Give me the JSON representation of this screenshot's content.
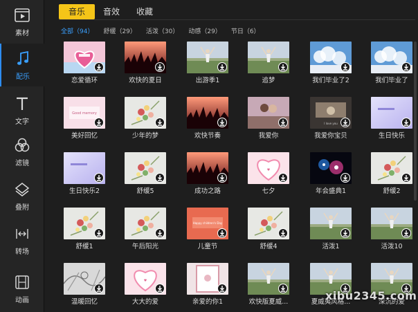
{
  "sidebar": {
    "items": [
      {
        "label": "素材",
        "icon": "media-icon"
      },
      {
        "label": "配乐",
        "icon": "music-note-icon",
        "active": true
      },
      {
        "label": "文字",
        "icon": "text-icon"
      },
      {
        "label": "滤镜",
        "icon": "filter-icon"
      },
      {
        "label": "叠附",
        "icon": "overlay-icon"
      },
      {
        "label": "转场",
        "icon": "transition-icon"
      },
      {
        "label": "动画",
        "icon": "animation-icon"
      }
    ]
  },
  "tabs": [
    {
      "label": "音乐",
      "active": true
    },
    {
      "label": "音效"
    },
    {
      "label": "收藏"
    }
  ],
  "filters": [
    {
      "label": "全部（94）",
      "active": true
    },
    {
      "label": "舒缓（29）"
    },
    {
      "label": "活泼（30）"
    },
    {
      "label": "动感（29）"
    },
    {
      "label": "节日（6）"
    }
  ],
  "tracks": [
    {
      "title": "恋爱循环",
      "thumb": "heart-pink"
    },
    {
      "title": "欢快的夏日",
      "thumb": "concert"
    },
    {
      "title": "出游季1",
      "thumb": "field"
    },
    {
      "title": "追梦",
      "thumb": "field"
    },
    {
      "title": "我们毕业了2",
      "thumb": "sky"
    },
    {
      "title": "我们毕业了",
      "thumb": "sky"
    },
    {
      "title": "美好回忆",
      "thumb": "pink-card",
      "caption": "Good memory"
    },
    {
      "title": "少年的梦",
      "thumb": "flowers"
    },
    {
      "title": "欢快节奏",
      "thumb": "concert"
    },
    {
      "title": "我爱你",
      "thumb": "couple"
    },
    {
      "title": "我爱你宝贝",
      "thumb": "dark-photo"
    },
    {
      "title": "生日快乐",
      "thumb": "lavender"
    },
    {
      "title": "生日快乐2",
      "thumb": "lavender"
    },
    {
      "title": "舒缓5",
      "thumb": "flowers"
    },
    {
      "title": "成功之路",
      "thumb": "concert"
    },
    {
      "title": "七夕",
      "thumb": "heart-light"
    },
    {
      "title": "年会盛典1",
      "thumb": "fireworks"
    },
    {
      "title": "舒缓2",
      "thumb": "flowers"
    },
    {
      "title": "舒缓1",
      "thumb": "flowers"
    },
    {
      "title": "午后阳光",
      "thumb": "flowers"
    },
    {
      "title": "儿童节",
      "thumb": "kids",
      "caption": "Happy children's Day"
    },
    {
      "title": "舒缓4",
      "thumb": "flowers"
    },
    {
      "title": "活泼1",
      "thumb": "field"
    },
    {
      "title": "活泼10",
      "thumb": "field"
    },
    {
      "title": "温暖回忆",
      "thumb": "sketch"
    },
    {
      "title": "大大的爱",
      "thumb": "heart-light"
    },
    {
      "title": "亲爱的你1",
      "thumb": "frame"
    },
    {
      "title": "欢快版夏威...",
      "thumb": "field"
    },
    {
      "title": "夏威夷风格...",
      "thumb": "field"
    },
    {
      "title": "深沉的爱",
      "thumb": "field"
    }
  ],
  "watermark": "xibu2345.com",
  "colors": {
    "accent": "#f5c518",
    "link": "#3aa0ff",
    "background": "#1e1e1e"
  }
}
